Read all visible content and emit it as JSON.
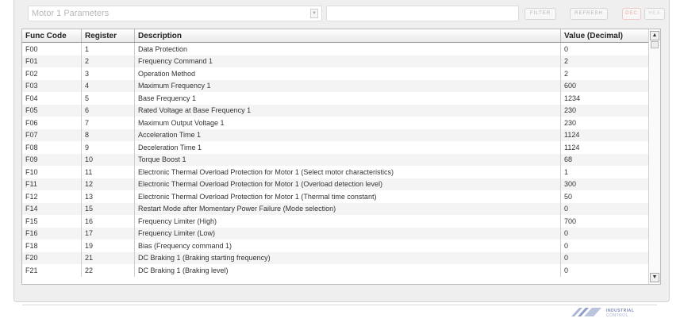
{
  "toolbar": {
    "parameter_group": "Motor 1 Parameters",
    "filter_value": "",
    "filter_label": "FILTER",
    "refresh_label": "REFRESH",
    "dec_label": "DEC",
    "hex_label": "HEX"
  },
  "table": {
    "columns": [
      "Func Code",
      "Register",
      "Description",
      "Value (Decimal)"
    ],
    "rows": [
      [
        "F00",
        "1",
        "Data Protection",
        "0"
      ],
      [
        "F01",
        "2",
        "Frequency Command 1",
        "2"
      ],
      [
        "F02",
        "3",
        "Operation Method",
        "2"
      ],
      [
        "F03",
        "4",
        "Maximum Frequency 1",
        "600"
      ],
      [
        "F04",
        "5",
        "Base Frequency 1",
        "1234"
      ],
      [
        "F05",
        "6",
        "Rated Voltage at Base Frequency 1",
        "230"
      ],
      [
        "F06",
        "7",
        "Maximum Output Voltage 1",
        "230"
      ],
      [
        "F07",
        "8",
        "Acceleration Time 1",
        "1124"
      ],
      [
        "F08",
        "9",
        "Deceleration Time 1",
        "1124"
      ],
      [
        "F09",
        "10",
        "Torque Boost 1",
        "68"
      ],
      [
        "F10",
        "11",
        "Electronic Thermal Overload Protection for Motor 1 (Select motor characteristics)",
        "1"
      ],
      [
        "F11",
        "12",
        "Electronic Thermal Overload Protection for Motor 1 (Overload detection level)",
        "300"
      ],
      [
        "F12",
        "13",
        "Electronic Thermal Overload Protection for Motor 1 (Thermal time constant)",
        "50"
      ],
      [
        "F14",
        "15",
        "Restart Mode after Momentary Power Failure (Mode selection)",
        "0"
      ],
      [
        "F15",
        "16",
        "Frequency Limiter (High)",
        "700"
      ],
      [
        "F16",
        "17",
        "Frequency Limiter (Low)",
        "0"
      ],
      [
        "F18",
        "19",
        "Bias (Frequency command 1)",
        "0"
      ],
      [
        "F20",
        "21",
        "DC Braking 1 (Braking starting frequency)",
        "0"
      ],
      [
        "F21",
        "22",
        "DC Braking 1 (Braking level)",
        "0"
      ]
    ]
  },
  "scrollbar": {
    "up_icon": "arrow-up-icon",
    "down_icon": "arrow-down-icon"
  },
  "logo": {
    "line1": "INDUSTRIAL",
    "line2": "CONTROL"
  },
  "colors": {
    "active_toggle": "#f2a3a3",
    "header_border": "#9c9c9c"
  }
}
